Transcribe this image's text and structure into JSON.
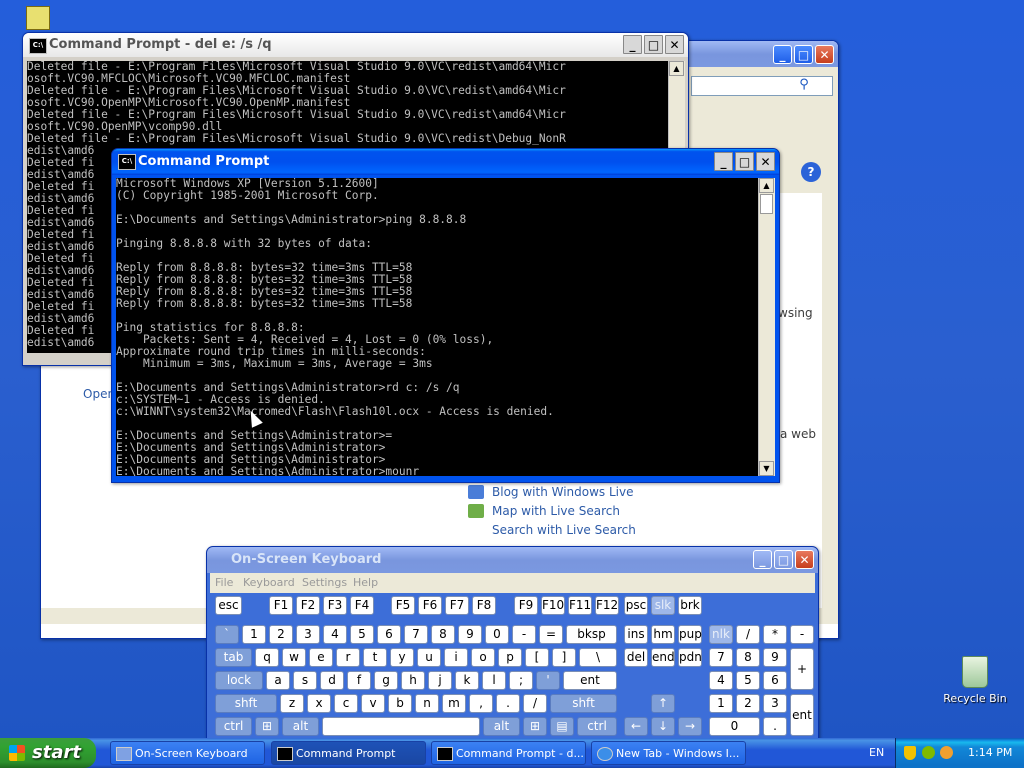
{
  "desktop": {
    "recycle_bin_label": "Recycle Bin"
  },
  "bg_window": {
    "fragments": {
      "open": "Open",
      "browsing": "wsing",
      "web": "a web",
      "blog": "Blog with Windows Live",
      "map": "Map with Live Search",
      "search": "Search with Live Search"
    }
  },
  "cmd_back": {
    "title": "Command Prompt - del e: /s /q",
    "lines": [
      "Deleted file - E:\\Program Files\\Microsoft Visual Studio 9.0\\VC\\redist\\amd64\\Micr",
      "osoft.VC90.MFCLOC\\Microsoft.VC90.MFCLOC.manifest",
      "Deleted file - E:\\Program Files\\Microsoft Visual Studio 9.0\\VC\\redist\\amd64\\Micr",
      "osoft.VC90.OpenMP\\Microsoft.VC90.OpenMP.manifest",
      "Deleted file - E:\\Program Files\\Microsoft Visual Studio 9.0\\VC\\redist\\amd64\\Micr",
      "osoft.VC90.OpenMP\\vcomp90.dll",
      "Deleted file - E:\\Program Files\\Microsoft Visual Studio 9.0\\VC\\redist\\Debug_NonR",
      "edist\\amd6",
      "Deleted fi",
      "edist\\amd6",
      "Deleted fi",
      "edist\\amd6",
      "Deleted fi",
      "edist\\amd6",
      "Deleted fi",
      "edist\\amd6",
      "Deleted fi",
      "edist\\amd6",
      "Deleted fi",
      "edist\\amd6",
      "Deleted fi",
      "edist\\amd6",
      "Deleted fi",
      "edist\\amd6"
    ]
  },
  "cmd_front": {
    "title": "Command Prompt",
    "lines": [
      "Microsoft Windows XP [Version 5.1.2600]",
      "(C) Copyright 1985-2001 Microsoft Corp.",
      "",
      "E:\\Documents and Settings\\Administrator>ping 8.8.8.8",
      "",
      "Pinging 8.8.8.8 with 32 bytes of data:",
      "",
      "Reply from 8.8.8.8: bytes=32 time=3ms TTL=58",
      "Reply from 8.8.8.8: bytes=32 time=3ms TTL=58",
      "Reply from 8.8.8.8: bytes=32 time=3ms TTL=58",
      "Reply from 8.8.8.8: bytes=32 time=3ms TTL=58",
      "",
      "Ping statistics for 8.8.8.8:",
      "    Packets: Sent = 4, Received = 4, Lost = 0 (0% loss),",
      "Approximate round trip times in milli-seconds:",
      "    Minimum = 3ms, Maximum = 3ms, Average = 3ms",
      "",
      "E:\\Documents and Settings\\Administrator>rd c: /s /q",
      "c:\\SYSTEM~1 - Access is denied.",
      "c:\\WINNT\\system32\\Macromed\\Flash\\Flash10l.ocx - Access is denied.",
      "",
      "E:\\Documents and Settings\\Administrator>=",
      "E:\\Documents and Settings\\Administrator>",
      "E:\\Documents and Settings\\Administrator>",
      "E:\\Documents and Settings\\Administrator>mounr"
    ]
  },
  "osk": {
    "title": "On-Screen Keyboard",
    "menu": [
      "File",
      "Keyboard",
      "Settings",
      "Help"
    ]
  },
  "taskbar": {
    "start_label": "start",
    "items": [
      {
        "label": "On-Screen Keyboard"
      },
      {
        "label": "Command Prompt"
      },
      {
        "label": "Command Prompt - d..."
      },
      {
        "label": "New Tab - Windows I..."
      }
    ],
    "lang": "EN",
    "clock": "1:14 PM"
  },
  "colors": {
    "desktop": "#245edb",
    "title_active": "#0053ee",
    "console_bg": "#000000",
    "console_fg": "#c0c0c0",
    "osk_body": "#3d6ed8"
  }
}
